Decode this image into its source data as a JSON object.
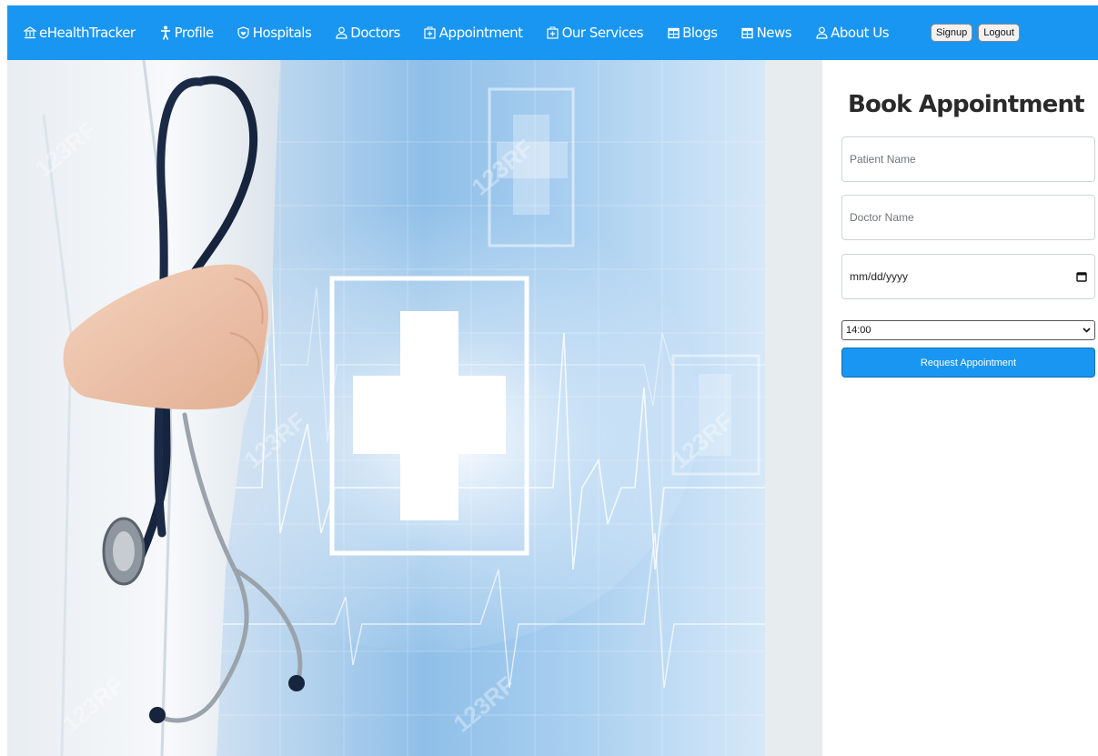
{
  "nav": {
    "brand": "eHealthTracker",
    "items": [
      {
        "label": "Profile",
        "icon": "person-icon"
      },
      {
        "label": "Hospitals",
        "icon": "shield-heart-icon"
      },
      {
        "label": "Doctors",
        "icon": "user-icon"
      },
      {
        "label": "Appointment",
        "icon": "medical-box-icon"
      },
      {
        "label": "Our Services",
        "icon": "medical-box-icon"
      },
      {
        "label": "Blogs",
        "icon": "layout-icon"
      },
      {
        "label": "News",
        "icon": "layout-icon"
      },
      {
        "label": "About Us",
        "icon": "user-icon"
      }
    ],
    "signup_label": "Signup",
    "logout_label": "Logout"
  },
  "hero": {
    "watermark": "123RF"
  },
  "form": {
    "title": "Book Appointment",
    "patient_placeholder": "Patient Name",
    "doctor_placeholder": "Doctor Name",
    "date_placeholder": "mm/dd/yyyy",
    "time_value": "14:00",
    "submit_label": "Request Appointment"
  },
  "colors": {
    "primary": "#1996f2",
    "strip": "#e7ecef"
  }
}
